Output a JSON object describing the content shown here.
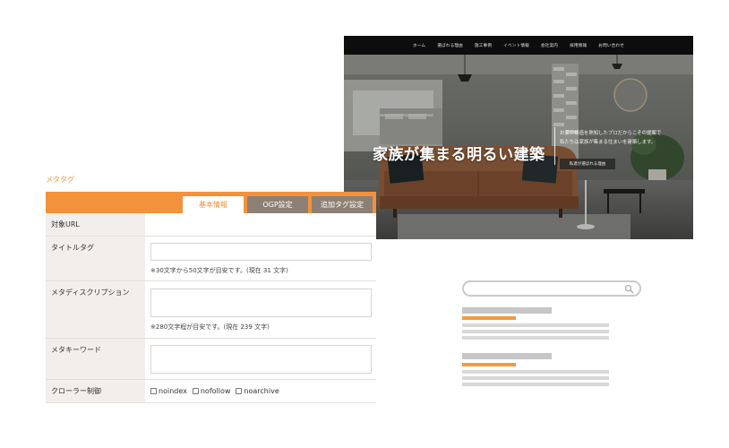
{
  "hero": {
    "nav": [
      "ホーム",
      "選ばれる理由",
      "施工事例",
      "イベント情報",
      "会社案内",
      "採用情報",
      "お問い合わせ"
    ],
    "title": "家族が集まる明るい建築",
    "copy_line1": "お家の構造を熟知したプロだからこその提案で",
    "copy_line2": "私たちは家族が集まる住まいを建築します。",
    "button_label": "私達が選ばれる理由"
  },
  "meta": {
    "heading": "メタタグ",
    "tabs": [
      "基本情報",
      "OGP設定",
      "追加タグ設定"
    ],
    "rows": {
      "url_label": "対象URL",
      "title_label": "タイトルタグ",
      "title_hint": "※30文字から50文字が目安です。(現在 31 文字)",
      "desc_label": "メタディスクリプション",
      "desc_hint": "※280文字程が目安です。(現在 239 文字)",
      "keyword_label": "メタキーワード",
      "crawler_label": "クローラー制御",
      "crawler_options": [
        "noindex",
        "nofollow",
        "noarchive"
      ]
    }
  },
  "colors": {
    "accent": "#f4913b",
    "tab_inactive": "#8c8075",
    "label_bg": "#f1eeeb",
    "wireframe_grey": "#d8d8d8"
  },
  "icons": {
    "search": "magnifier-icon"
  }
}
